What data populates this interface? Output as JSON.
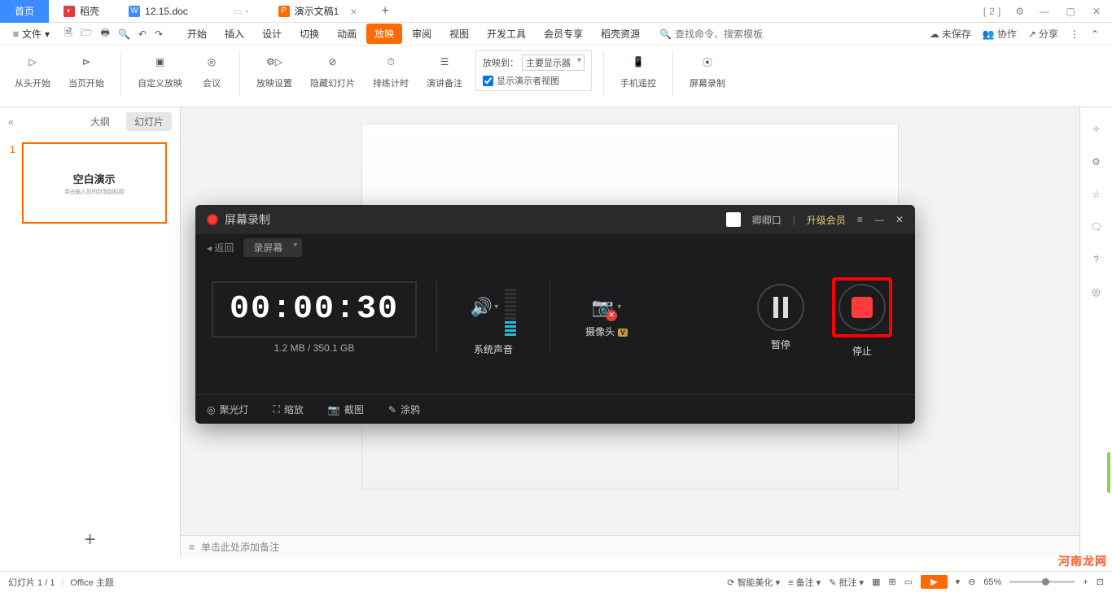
{
  "tabs": {
    "home": "首页",
    "doc1": "稻壳",
    "doc2": "12.15.doc",
    "doc3": "演示文稿1"
  },
  "window_badge": "2",
  "menu": {
    "file": "文件",
    "items": [
      "开始",
      "插入",
      "设计",
      "切换",
      "动画",
      "放映",
      "审阅",
      "视图",
      "开发工具",
      "会员专享",
      "稻壳资源"
    ],
    "active_index": 5,
    "search_placeholder": "查找命令、搜索模板",
    "unsaved": "未保存",
    "collab": "协作",
    "share": "分享"
  },
  "ribbon": {
    "g1": "从头开始",
    "g2": "当页开始",
    "g3": "自定义放映",
    "g4": "会议",
    "g5": "放映设置",
    "g6": "隐藏幻灯片",
    "g7": "排练计时",
    "g8": "演讲备注",
    "proj_label": "放映到：",
    "proj_value": "主要显示器",
    "presenter_view": "显示演示者视图",
    "g9": "手机遥控",
    "g10": "屏幕录制"
  },
  "side": {
    "outline": "大纲",
    "slides": "幻灯片",
    "thumb_num": "1",
    "thumb_title": "空白演示",
    "thumb_sub": "单击输入您的封面副标题"
  },
  "notes_placeholder": "单击此处添加备注",
  "status": {
    "slide_info": "幻灯片 1 / 1",
    "theme": "Office 主题",
    "beautify": "智能美化",
    "notes": "备注",
    "comments": "批注",
    "zoom": "65%"
  },
  "watermark": "河南龙网",
  "rec": {
    "title": "屏幕录制",
    "user": "卿卿口",
    "upgrade": "升级会员",
    "back": "返回",
    "mode": "录屏幕",
    "timer": "00:00:30",
    "size": "1.2 MB / 350.1 GB",
    "sound": "系统声音",
    "camera": "摄像头",
    "vip": "V",
    "pause": "暂停",
    "stop": "停止",
    "spotlight": "聚光灯",
    "zoom": "缩放",
    "screenshot": "截图",
    "draw": "涂鸦"
  }
}
